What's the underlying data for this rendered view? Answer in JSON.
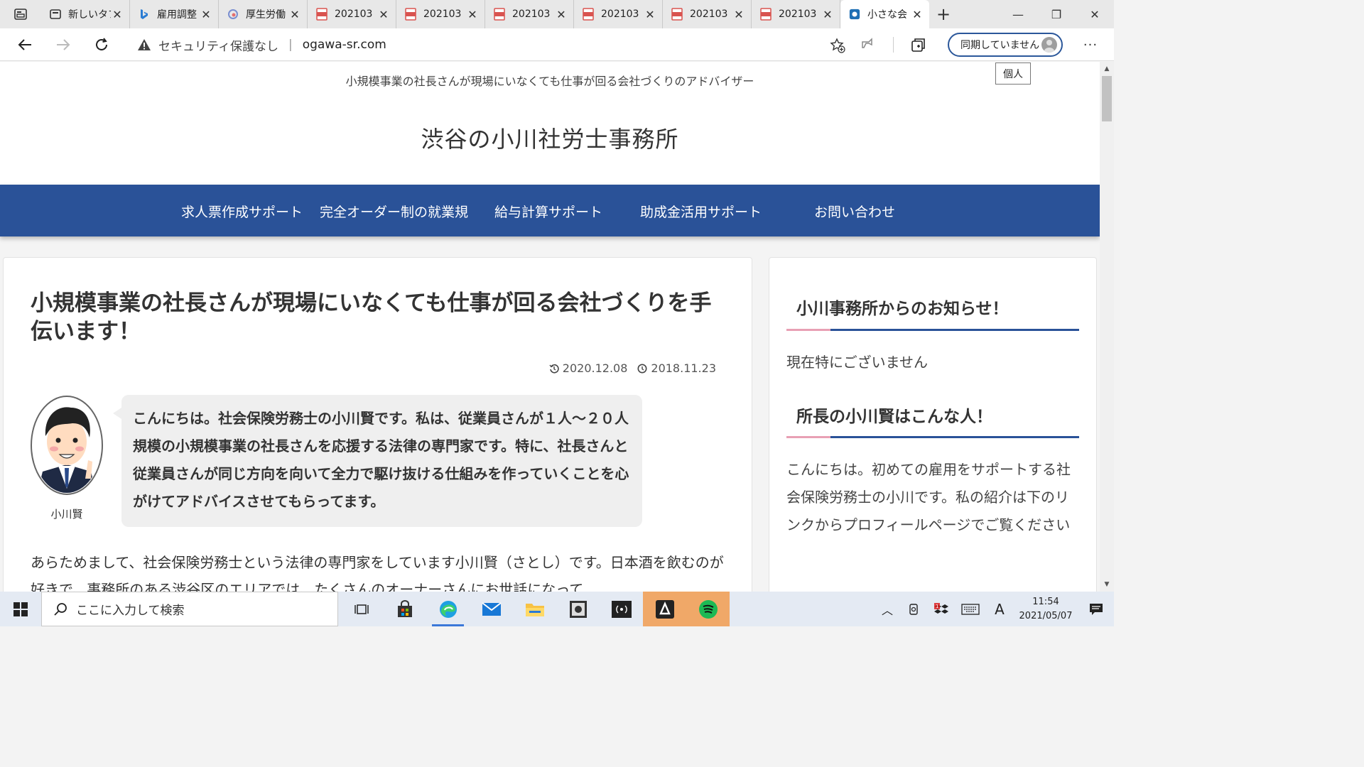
{
  "browser": {
    "tabs": [
      {
        "label": "新しいタブ",
        "icon": "new-tab-icon",
        "active": false
      },
      {
        "label": "雇用調整",
        "icon": "bing-icon",
        "active": false
      },
      {
        "label": "厚生労働",
        "icon": "mhlw-icon",
        "active": false
      },
      {
        "label": "202103",
        "icon": "pdf-icon",
        "active": false
      },
      {
        "label": "202103",
        "icon": "pdf-icon",
        "active": false
      },
      {
        "label": "202103",
        "icon": "pdf-icon",
        "active": false
      },
      {
        "label": "202103",
        "icon": "pdf-icon",
        "active": false
      },
      {
        "label": "202103",
        "icon": "pdf-icon",
        "active": false
      },
      {
        "label": "202103",
        "icon": "pdf-icon",
        "active": false
      },
      {
        "label": "小さな会",
        "icon": "site-icon",
        "active": true
      }
    ],
    "address": {
      "security_text": "セキュリティ保護なし",
      "separator": "|",
      "url": "ogawa-sr.com"
    },
    "sync_label": "同期していません",
    "tooltip": "個人"
  },
  "page": {
    "tagline": "小規模事業の社長さんが現場にいなくても仕事が回る会社づくりのアドバイザー",
    "site_title": "渋谷の小川社労士事務所",
    "nav": [
      "求人票作成サポート",
      "完全オーダー制の就業規",
      "給与計算サポート",
      "助成金活用サポート",
      "お問い合わせ"
    ],
    "article": {
      "title": "小規模事業の社長さんが現場にいなくても仕事が回る会社づくりを手伝います！",
      "updated": "2020.12.08",
      "published": "2018.11.23",
      "avatar_name": "小川賢",
      "bubble": "こんにちは。社会保険労務士の小川賢です。私は、従業員さんが１人～２０人規模の小規模事業の社長さんを応援する法律の専門家です。特に、社長さんと従業員さんが同じ方向を向いて全力で駆け抜ける仕組みを作っていくことを心がけてアドバイスさせてもらってます。",
      "body": "あらためまして、社会保険労務士という法律の専門家をしています小川賢（さとし）です。日本酒を飲むのが好きで、事務所のある渋谷区のエリアでは、たくさんのオーナーさんにお世話になって"
    },
    "sidebar": {
      "notice_heading": "小川事務所からのお知らせ！",
      "notice_text": "現在特にございません",
      "profile_heading": "所長の小川賢はこんな人！",
      "profile_text": "こんにちは。初めての雇用をサポートする社会保険労務士の小川です。私の紹介は下のリンクからプロフィールページでご覧ください"
    },
    "colors": {
      "nav_bg": "#2a5298",
      "accent_pink": "#e8a0b4"
    }
  },
  "taskbar": {
    "search_placeholder": "ここに入力して検索",
    "apps": [
      "task-view-icon",
      "store-icon",
      "edge-icon",
      "mail-icon",
      "file-explorer-icon",
      "app-icon",
      "broadcast-icon",
      "app-icon-2",
      "spotify-icon"
    ],
    "ime": "A",
    "time": "11:54",
    "date": "2021/05/07"
  }
}
